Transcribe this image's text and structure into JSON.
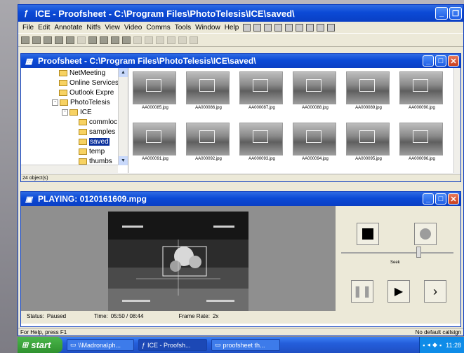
{
  "app": {
    "title": "ICE - Proofsheet - C:\\Program Files\\PhotoTelesis\\ICE\\saved\\",
    "menu": [
      "File",
      "Edit",
      "Annotate",
      "Nitfs",
      "View",
      "Video",
      "Comms",
      "Tools",
      "Window",
      "Help"
    ],
    "status_left": "For Help, press F1",
    "status_right": "No default callsign"
  },
  "proofsheet": {
    "title": "Proofsheet - C:\\Program Files\\PhotoTelesis\\ICE\\saved\\",
    "tree": [
      {
        "label": "NetMeeting",
        "level": 1
      },
      {
        "label": "Online Services",
        "level": 1
      },
      {
        "label": "Outlook Expre",
        "level": 1
      },
      {
        "label": "PhotoTelesis",
        "level": 1,
        "expander": "-"
      },
      {
        "label": "ICE",
        "level": 2,
        "expander": "-"
      },
      {
        "label": "commloc",
        "level": 3
      },
      {
        "label": "samples",
        "level": 3
      },
      {
        "label": "saved",
        "level": 3,
        "selected": true
      },
      {
        "label": "temp",
        "level": 3
      },
      {
        "label": "thumbs",
        "level": 3
      }
    ],
    "thumbnails": [
      "AA000085.jpg",
      "AA000086.jpg",
      "AA000087.jpg",
      "AA000088.jpg",
      "AA000089.jpg",
      "AA000090.jpg",
      "AA000091.jpg",
      "AA000092.jpg",
      "AA000093.jpg",
      "AA000094.jpg",
      "AA000095.jpg",
      "AA000096.jpg"
    ],
    "status": "24 object(s)"
  },
  "player": {
    "title": "PLAYING:  0120161609.mpg",
    "status_label": "Status:",
    "status_value": "Paused",
    "time_label": "Time:",
    "time_value": "05:50 / 08:44",
    "framerate_label": "Frame Rate:",
    "framerate_value": "2x",
    "seek_label": "Seek"
  },
  "taskbar": {
    "start": "start",
    "buttons": [
      "\\\\Madrona\\ph...",
      "ICE - Proofsh...",
      "proofsheet th..."
    ],
    "clock": "11:28"
  }
}
